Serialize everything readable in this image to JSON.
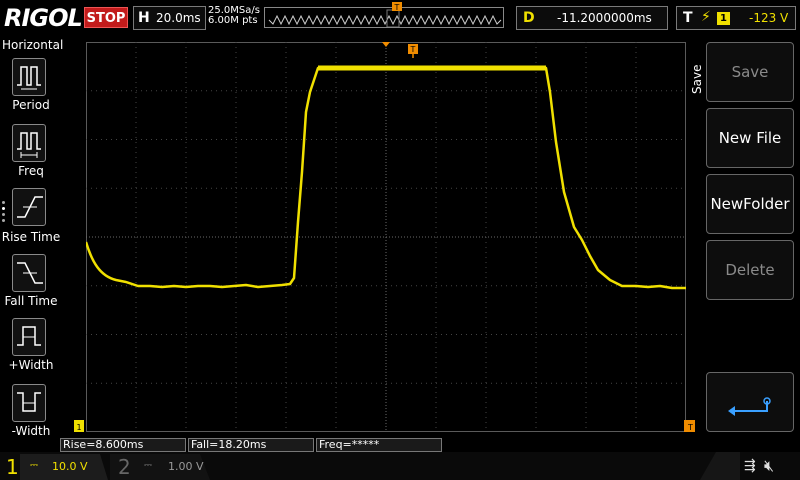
{
  "header": {
    "logo": "RIGOL",
    "run_state": "STOP",
    "timebase_label": "H",
    "timebase_value": "20.0ms",
    "sample_rate": "25.0MSa/s",
    "mem_depth": "6.00M pts",
    "delay_label": "D",
    "delay_value": "-11.2000000ms",
    "trigger_label": "T",
    "trigger_source": "1",
    "trigger_level": "-123 V"
  },
  "left_panel": {
    "title": "Horizontal",
    "items": [
      {
        "label": "Period",
        "icon": "period-icon"
      },
      {
        "label": "Freq",
        "icon": "freq-icon"
      },
      {
        "label": "Rise Time",
        "icon": "rise-time-icon"
      },
      {
        "label": "Fall Time",
        "icon": "fall-time-icon"
      },
      {
        "label": "+Width",
        "icon": "positive-width-icon"
      },
      {
        "label": "-Width",
        "icon": "negative-width-icon"
      }
    ]
  },
  "right_panel": {
    "title": "Save",
    "buttons": [
      {
        "label": "Save",
        "state": "disabled"
      },
      {
        "label": "New File",
        "state": "enabled"
      },
      {
        "label": "NewFolder",
        "state": "enabled"
      },
      {
        "label": "Delete",
        "state": "disabled"
      }
    ],
    "return_icon": "return-arrow-icon"
  },
  "measurements": {
    "rise": "Rise=8.600ms",
    "fall": "Fall=18.20ms",
    "freq": "Freq=*****"
  },
  "channels": {
    "ch1_num": "1",
    "ch1_scale": "10.0 V",
    "ch2_num": "2",
    "ch2_scale": "1.00 V"
  },
  "colors": {
    "ch1": "#f0e000",
    "stop": "#c21b1b",
    "grid": "#5a5a5a",
    "accent": "#f08c00",
    "return_icon": "#3aa0ff"
  }
}
